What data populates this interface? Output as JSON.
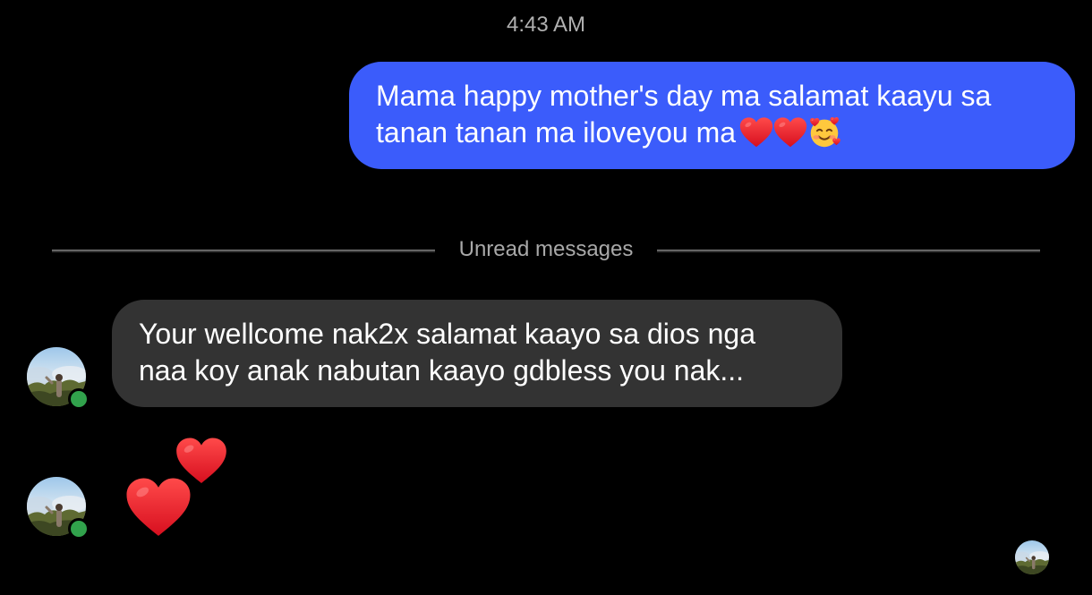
{
  "chat": {
    "timestamp": "4:43 AM",
    "outgoing_message": {
      "text": "Mama happy mother's day ma salamat kaayu sa\ntanan tanan ma iloveyou ma",
      "emojis": [
        "red-heart",
        "red-heart",
        "smiling-face-with-hearts"
      ],
      "bubble_color": "#3b5cfb"
    },
    "unread_divider": {
      "label": "Unread messages"
    },
    "incoming_message": {
      "text": "Your wellcome nak2x salamat kaayo sa dios nga\nnaa koy anak nabutan kaayo gdbless you  nak...",
      "bubble_color": "#333333"
    },
    "incoming_reaction": {
      "emojis": [
        "red-heart",
        "red-heart"
      ]
    },
    "contact": {
      "online": true,
      "status_color": "#31a24c"
    }
  }
}
